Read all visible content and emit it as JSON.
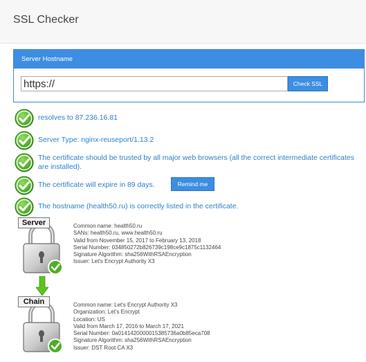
{
  "header": {
    "title": "SSL Checker"
  },
  "form": {
    "panel_title": "Server Hostname",
    "input_value": "https://",
    "check_button": "Check SSL"
  },
  "results": [
    {
      "text": "resolves to 87.236.16.81"
    },
    {
      "text": "Server Type: nginx-reuseport/1.13.2"
    },
    {
      "text": "The certificate should be trusted by all major web browsers (all the correct intermediate certificates are installed)."
    },
    {
      "text": "The certificate will expire in 89 days."
    },
    {
      "text": "The hostname (health50.ru) is correctly listed in the certificate."
    }
  ],
  "remind_button": "Remind me",
  "certificates": [
    {
      "badge": "Server",
      "lines": [
        "Common name: health50.ru",
        "SANs: health50.ru, www.health50.ru",
        "Valid from November 15, 2017 to February 13, 2018",
        "Serial Number: 034850272b826739c198ce9c1875c1132464",
        "Signature Algorithm: sha256WithRSAEncryption",
        "Issuer: Let's Encrypt Authority X3"
      ]
    },
    {
      "badge": "Chain",
      "lines": [
        "Common name: Let's Encrypt Authority X3",
        "Organization: Let's Encrypt",
        "Location: US",
        "Valid from March 17, 2016 to March 17, 2021",
        "Serial Number: 0a0141420000015385736a0b85eca708",
        "Signature Algorithm: sha256WithRSAEncryption",
        "Issuer: DST Root CA X3"
      ]
    }
  ],
  "colors": {
    "accent": "#3d8ee2",
    "link_text": "#2c7fc9",
    "check_green": "#4caf24",
    "arrow_green": "#5dc21e"
  },
  "icons": {
    "check": "check-circle-icon",
    "padlock": "padlock-icon",
    "arrow": "arrow-down-icon"
  }
}
